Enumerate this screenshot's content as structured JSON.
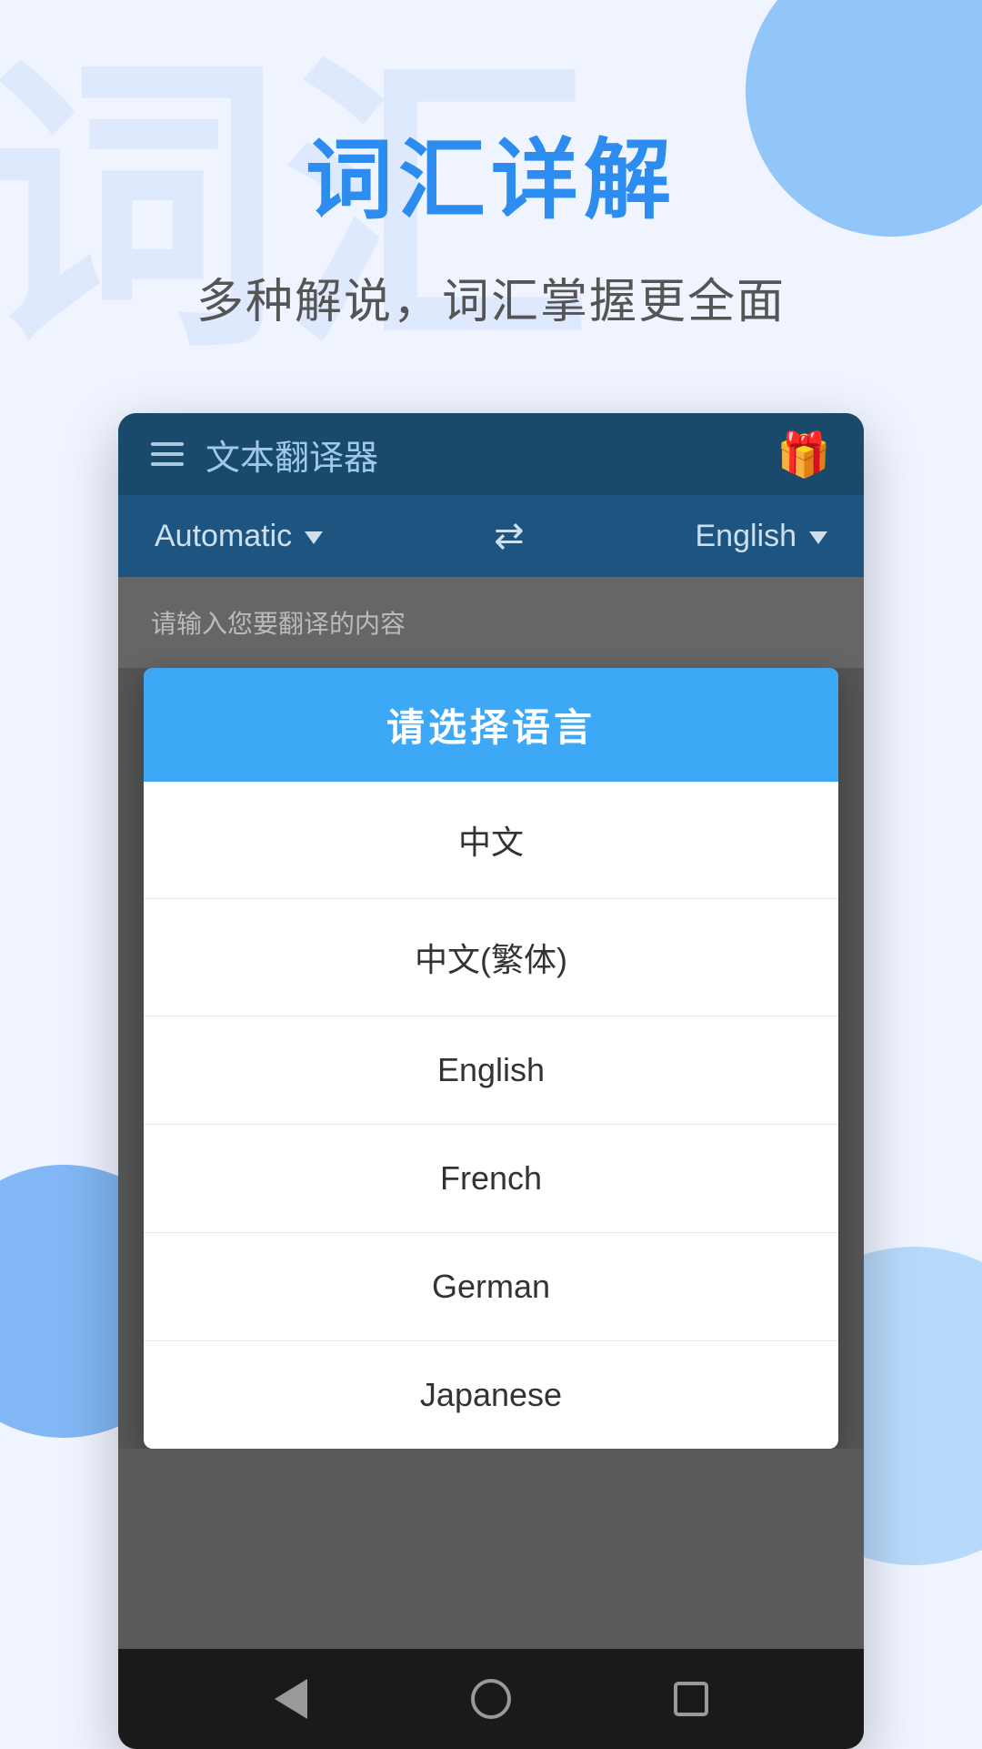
{
  "background": {
    "watermark1": "词",
    "watermark2": "汇"
  },
  "header": {
    "main_title": "词汇详解",
    "sub_title": "多种解说，词汇掌握更全面"
  },
  "app": {
    "topbar": {
      "title": "文本翻译器",
      "gift_icon": "🎁"
    },
    "lang_bar": {
      "source_lang": "Automatic",
      "target_lang": "English",
      "swap_symbol": "⇄"
    },
    "input": {
      "placeholder": "请输入您要翻译的内容"
    },
    "dialog": {
      "title": "请选择语言",
      "languages": [
        {
          "id": "zh",
          "label": "中文"
        },
        {
          "id": "zh-tw",
          "label": "中文(繁体)"
        },
        {
          "id": "en",
          "label": "English"
        },
        {
          "id": "fr",
          "label": "French"
        },
        {
          "id": "de",
          "label": "German"
        },
        {
          "id": "ja",
          "label": "Japanese"
        }
      ]
    }
  },
  "bottom_nav": {
    "back_label": "back",
    "home_label": "home",
    "recents_label": "recents"
  }
}
